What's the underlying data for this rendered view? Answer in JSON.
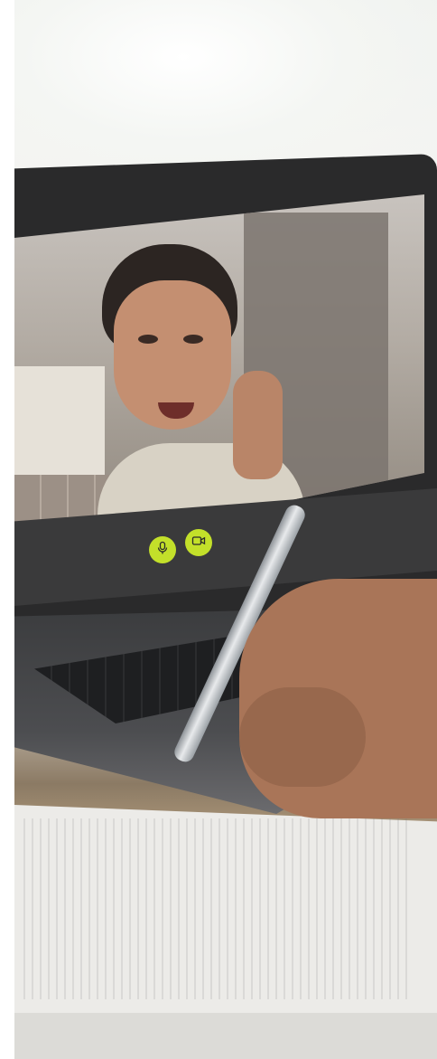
{
  "scene": {
    "type": "video-call-laptop-photo",
    "accent_color": "#c3e02a"
  },
  "controls": {
    "mic_icon": "microphone-icon",
    "camera_icon": "video-camera-icon"
  }
}
